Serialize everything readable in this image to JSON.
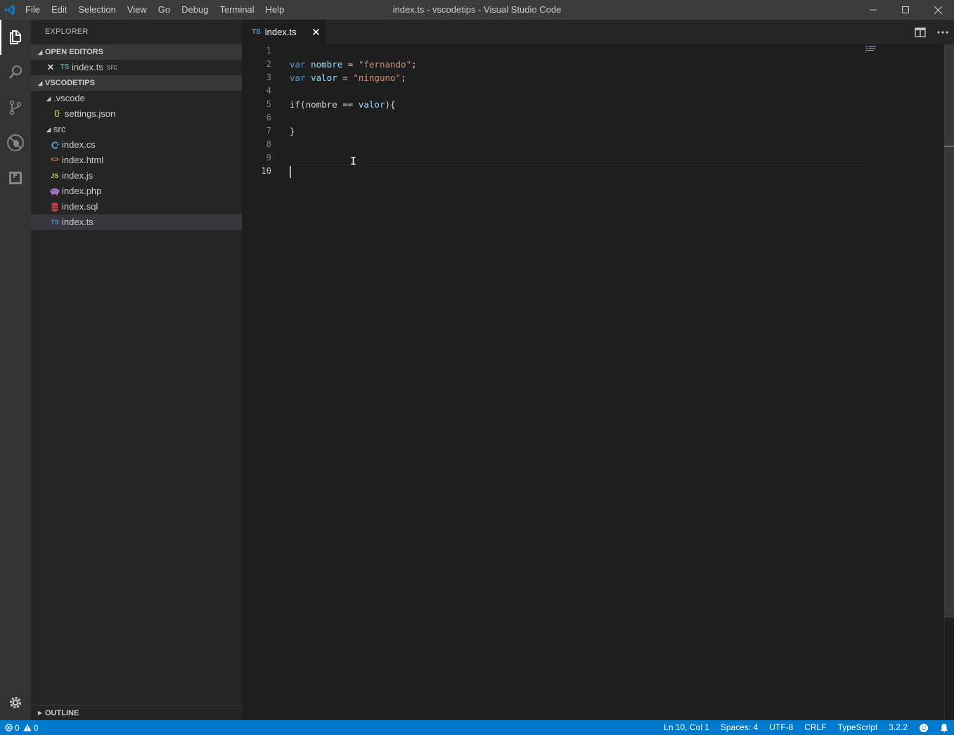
{
  "titlebar": {
    "title": "index.ts - vscodetips - Visual Studio Code",
    "menu": [
      "File",
      "Edit",
      "Selection",
      "View",
      "Go",
      "Debug",
      "Terminal",
      "Help"
    ]
  },
  "sidebar": {
    "title": "EXPLORER",
    "open_editors": {
      "header": "OPEN EDITORS",
      "items": [
        {
          "badge": "TS",
          "label": "index.ts",
          "suffix": "src"
        }
      ]
    },
    "workspace": {
      "header": "VSCODETIPS",
      "tree": [
        {
          "label": ".vscode",
          "type": "folder"
        },
        {
          "label": "settings.json",
          "badge": "{}",
          "type": "file"
        },
        {
          "label": "src",
          "type": "folder"
        },
        {
          "label": "index.cs",
          "badge": "C#",
          "type": "file"
        },
        {
          "label": "index.html",
          "badge": "<>",
          "type": "file"
        },
        {
          "label": "index.js",
          "badge": "JS",
          "type": "file"
        },
        {
          "label": "index.php",
          "badge": "php",
          "type": "file"
        },
        {
          "label": "index.sql",
          "badge": "db",
          "type": "file"
        },
        {
          "label": "index.ts",
          "badge": "TS",
          "type": "file",
          "selected": true
        }
      ]
    },
    "outline": "OUTLINE"
  },
  "editor": {
    "tab": {
      "badge": "TS",
      "label": "index.ts",
      "close": "×"
    },
    "line_numbers": [
      "1",
      "2",
      "3",
      "4",
      "5",
      "6",
      "7",
      "8",
      "9",
      "10"
    ],
    "current_line": 10,
    "code": {
      "l2": {
        "kw": "var",
        "name": "nombre",
        "op": " = ",
        "str": "\"fernando\"",
        "end": ";"
      },
      "l3": {
        "kw": "var",
        "name": "valor",
        "op": " = ",
        "str": "\"ninguno\"",
        "end": ";"
      },
      "l5": {
        "pre": "if(nombre == ",
        "var": "valor",
        "post": "){"
      },
      "l7": "}"
    }
  },
  "statusbar": {
    "errors": "0",
    "warnings": "0",
    "position": "Ln 10, Col 1",
    "spaces": "Spaces: 4",
    "encoding": "UTF-8",
    "eol": "CRLF",
    "language": "TypeScript",
    "version": "3.2.2"
  },
  "colors": {
    "accent": "#007acc",
    "activitybar": "#333333",
    "sidebar": "#252526",
    "editor": "#1e1e1e",
    "keyword": "#569cd6",
    "variable": "#9cdcfe",
    "string": "#ce9178"
  }
}
